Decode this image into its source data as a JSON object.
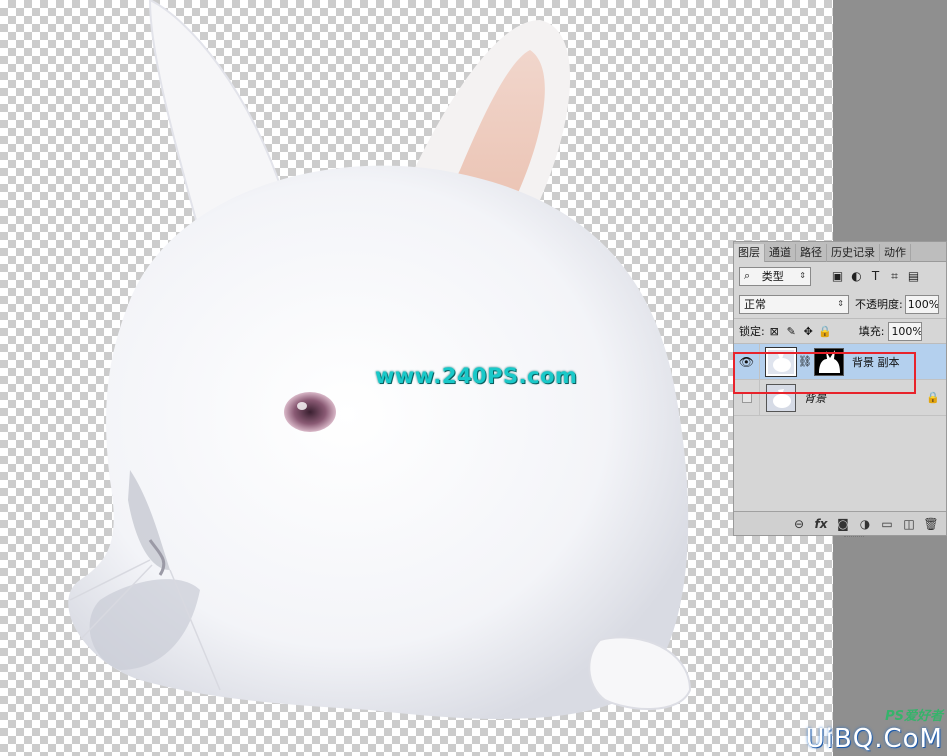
{
  "canvas": {
    "watermark": "www.240PS.com"
  },
  "layers_panel": {
    "tabs": [
      "图层",
      "通道",
      "路径",
      "历史记录",
      "动作"
    ],
    "kind_filter": "类型",
    "blend_mode": "正常",
    "opacity_label": "不透明度:",
    "opacity_value": "100%",
    "lock_label": "锁定:",
    "fill_label": "填充:",
    "fill_value": "100%",
    "layers": [
      {
        "name": "背景 副本",
        "visible": true,
        "selected": true,
        "has_mask": true
      },
      {
        "name": "背景",
        "visible": false,
        "selected": false,
        "locked": true
      }
    ]
  },
  "site_logo": {
    "top": "PS爱好者",
    "bottom": "UiBQ.CoM"
  },
  "colors": {
    "selection_highlight": "#e8232b",
    "selected_layer": "#b4d0ee",
    "watermark": "#19c9c9"
  }
}
